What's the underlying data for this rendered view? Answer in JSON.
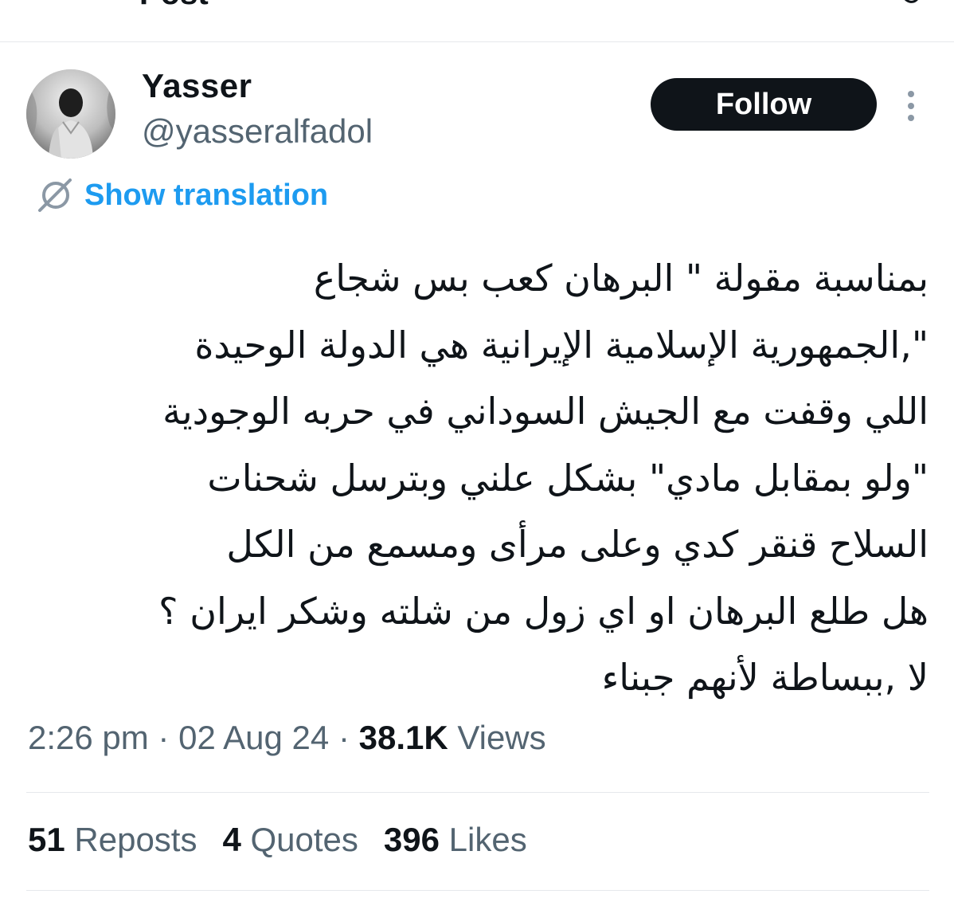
{
  "header": {
    "title": "Post"
  },
  "author": {
    "display_name": "Yasser",
    "handle": "@yasseralfadol"
  },
  "actions": {
    "follow_label": "Follow",
    "more_icon": "more-vertical-icon"
  },
  "translation": {
    "label": "Show translation",
    "icon": "translate-icon"
  },
  "tweet": {
    "lines": [
      "بمناسبة مقولة \" البرهان كعب بس شجاع",
      "\",الجمهورية الإسلامية الإيرانية هي الدولة الوحيدة",
      "اللي وقفت مع الجيش السوداني في حربه الوجودية",
      "\"ولو بمقابل مادي\" بشكل علني وبترسل شحنات",
      "السلاح قنقر كدي وعلى مرأى ومسمع من الكل",
      "هل طلع البرهان او اي زول من شلته وشكر ايران ؟",
      "لا ,ببساطة لأنهم جبناء"
    ]
  },
  "meta": {
    "time": "2:26 pm",
    "separator": " · ",
    "date": "02 Aug 24",
    "views_count": "38.1K",
    "views_label": "Views"
  },
  "stats": {
    "reposts_count": "51",
    "reposts_label": "Reposts",
    "quotes_count": "4",
    "quotes_label": "Quotes",
    "likes_count": "396",
    "likes_label": "Likes"
  },
  "colors": {
    "text": "#0f1419",
    "secondary": "#536471",
    "link": "#1d9bf0",
    "divider": "#e6e9ec"
  }
}
